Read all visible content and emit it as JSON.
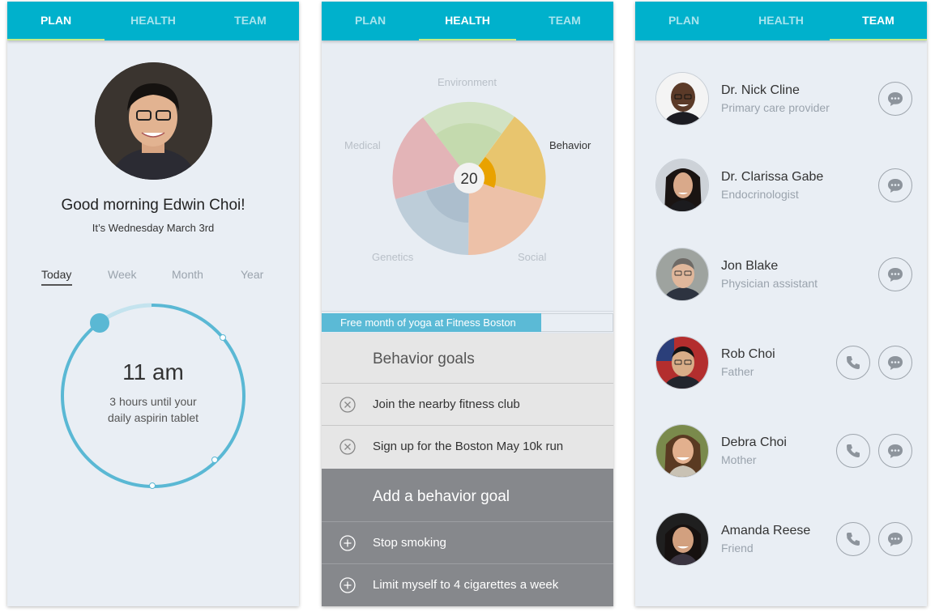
{
  "tabs": [
    "PLAN",
    "HEALTH",
    "TEAM"
  ],
  "plan": {
    "greeting": "Good morning Edwin Choi!",
    "date": "It’s Wednesday March 3rd",
    "ranges": [
      "Today",
      "Week",
      "Month",
      "Year"
    ],
    "active_range": "Today",
    "dial": {
      "time": "11 am",
      "description_line1": "3 hours until your",
      "description_line2": "daily aspirin tablet"
    }
  },
  "health": {
    "score": "20",
    "wheel": {
      "labels": [
        "Environment",
        "Behavior",
        "Social",
        "Genetics",
        "Medical"
      ],
      "active": "Behavior"
    },
    "promo": "Free month of yoga at Fitness Boston",
    "behavior_goals": {
      "title": "Behavior goals",
      "items": [
        "Join the nearby fitness club",
        "Sign up for the Boston May 10k run"
      ]
    },
    "add_goal": {
      "title": "Add a behavior goal",
      "items": [
        "Stop smoking",
        "Limit myself to 4 cigarettes a week"
      ]
    }
  },
  "team": {
    "members": [
      {
        "name": "Dr. Nick Cline",
        "role": "Primary care provider",
        "can_call": false
      },
      {
        "name": "Dr. Clarissa Gabe",
        "role": "Endocrinologist",
        "can_call": false
      },
      {
        "name": "Jon Blake",
        "role": "Physician assistant",
        "can_call": false
      },
      {
        "name": "Rob Choi",
        "role": "Father",
        "can_call": true
      },
      {
        "name": "Debra Choi",
        "role": "Mother",
        "can_call": true
      },
      {
        "name": "Amanda Reese",
        "role": "Friend",
        "can_call": true
      }
    ]
  },
  "colors": {
    "tab_bar": "#00b1cc",
    "tab_indicator": "#c8ec86",
    "dial": "#5ab8d4",
    "promo": "#5bbad6",
    "add_card": "#86888c",
    "wheel_environment": "#c9dcb4",
    "wheel_behavior": "#e8c56e",
    "wheel_social": "#edbba0",
    "wheel_genetics": "#b8c9d6",
    "wheel_medical": "#e3adb0"
  },
  "icons": {
    "remove": "circle-x-icon",
    "add": "circle-plus-icon",
    "message": "speech-bubble-icon",
    "call": "phone-icon"
  }
}
